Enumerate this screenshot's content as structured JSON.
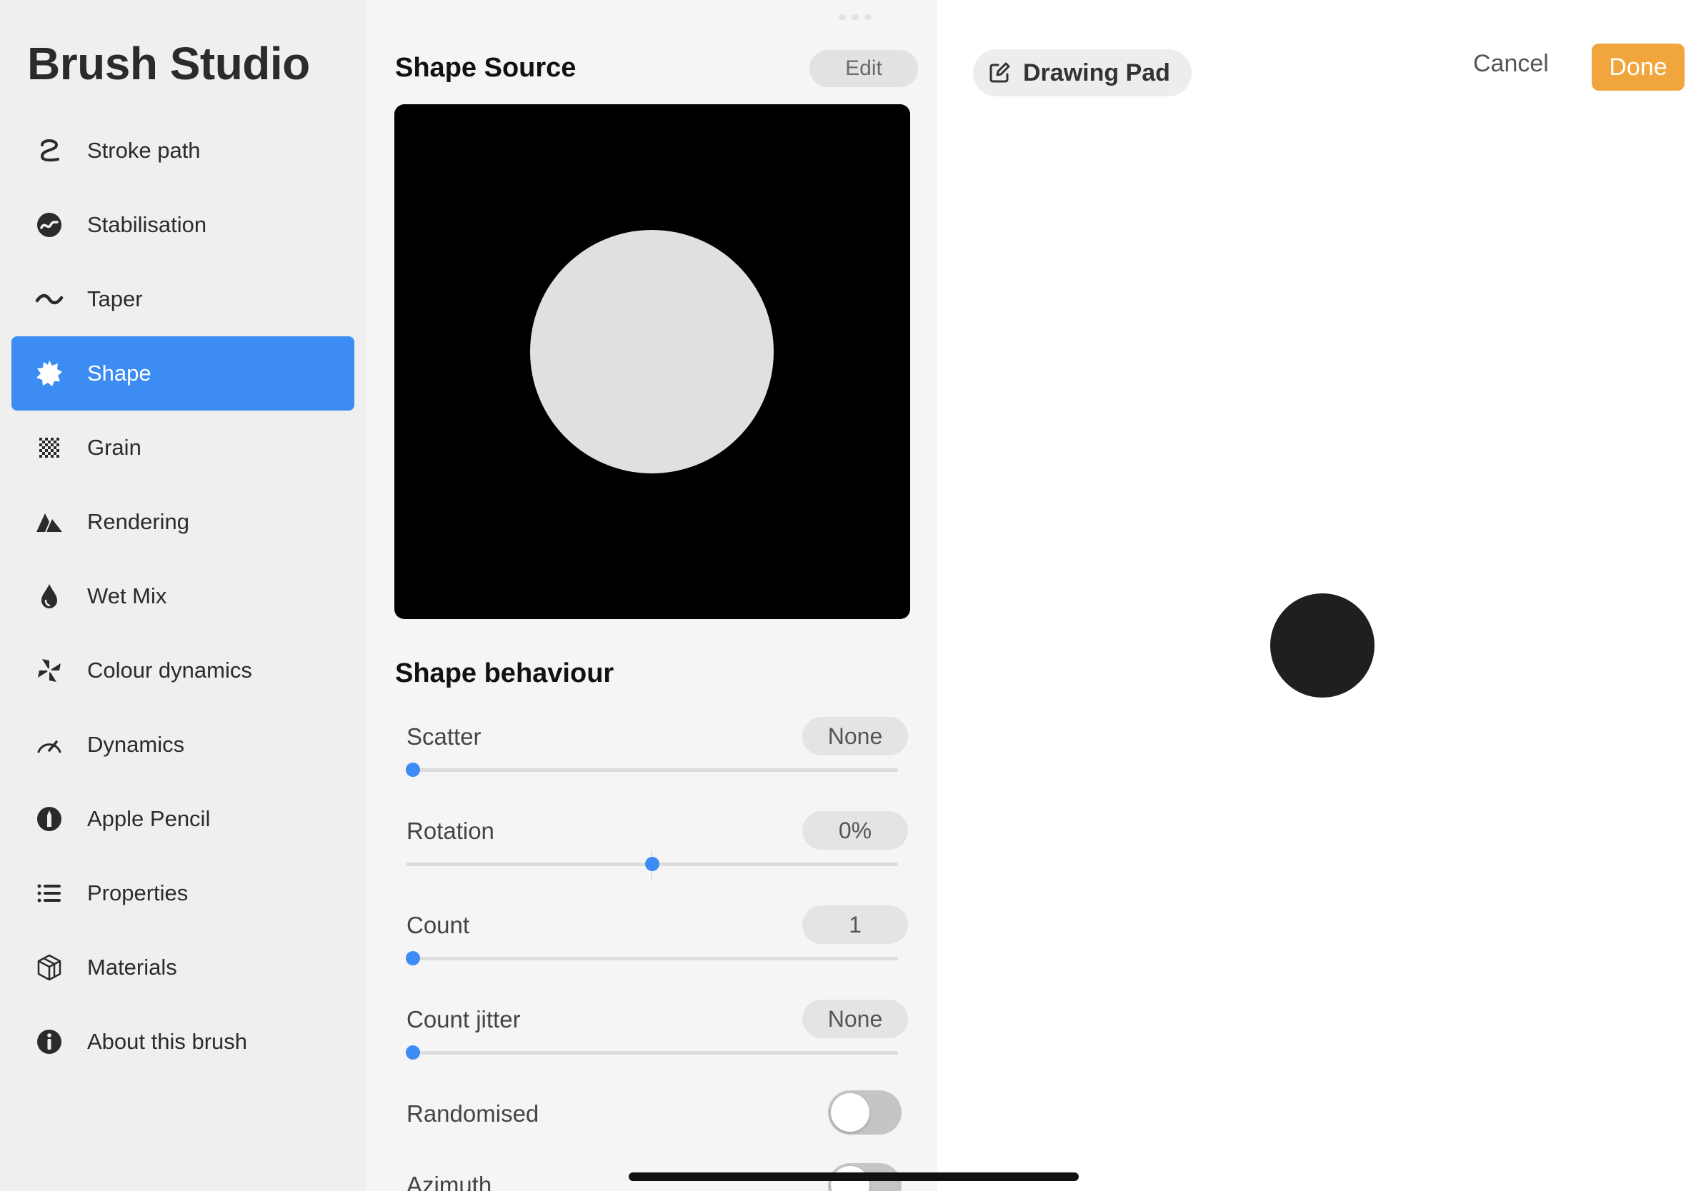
{
  "sidebar": {
    "title": "Brush Studio",
    "items": [
      {
        "label": "Stroke path",
        "icon": "stroke-path-icon",
        "active": false
      },
      {
        "label": "Stabilisation",
        "icon": "stabilisation-icon",
        "active": false
      },
      {
        "label": "Taper",
        "icon": "taper-icon",
        "active": false
      },
      {
        "label": "Shape",
        "icon": "shape-icon",
        "active": true
      },
      {
        "label": "Grain",
        "icon": "grain-icon",
        "active": false
      },
      {
        "label": "Rendering",
        "icon": "rendering-icon",
        "active": false
      },
      {
        "label": "Wet Mix",
        "icon": "wet-mix-icon",
        "active": false
      },
      {
        "label": "Colour dynamics",
        "icon": "colour-dynamics-icon",
        "active": false
      },
      {
        "label": "Dynamics",
        "icon": "dynamics-icon",
        "active": false
      },
      {
        "label": "Apple Pencil",
        "icon": "apple-pencil-icon",
        "active": false
      },
      {
        "label": "Properties",
        "icon": "properties-icon",
        "active": false
      },
      {
        "label": "Materials",
        "icon": "materials-icon",
        "active": false
      },
      {
        "label": "About this brush",
        "icon": "info-icon",
        "active": false
      }
    ]
  },
  "shape_source": {
    "title": "Shape Source",
    "edit_label": "Edit"
  },
  "shape_behaviour": {
    "title": "Shape behaviour",
    "scatter": {
      "label": "Scatter",
      "value": "None",
      "level": 0.0
    },
    "rotation": {
      "label": "Rotation",
      "value": "0%",
      "level": 0.5
    },
    "count": {
      "label": "Count",
      "value": "1",
      "level": 0.0
    },
    "count_jitter": {
      "label": "Count jitter",
      "value": "None",
      "level": 0.0
    },
    "randomised": {
      "label": "Randomised",
      "on": false
    },
    "azimuth": {
      "label": "Azimuth",
      "on": false
    }
  },
  "drawing_pad": {
    "label": "Drawing Pad",
    "icon": "edit-icon"
  },
  "actions": {
    "cancel_label": "Cancel",
    "done_label": "Done"
  },
  "colors": {
    "accent": "#3d8cf3",
    "done": "#f0a63c"
  }
}
